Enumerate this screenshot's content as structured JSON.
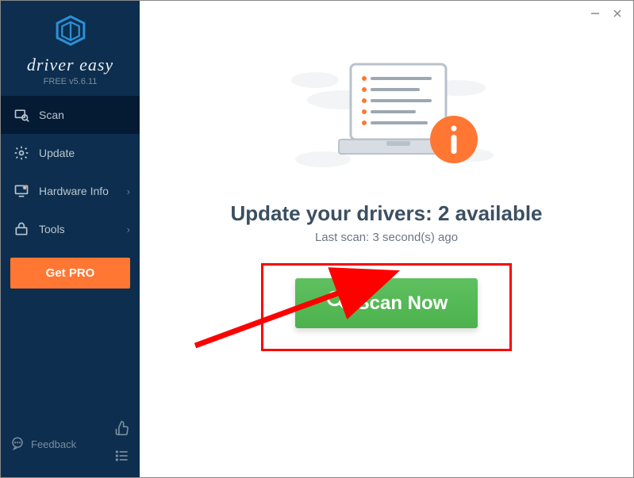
{
  "brand": {
    "name": "driver easy",
    "version": "FREE v5.6.11"
  },
  "sidebar": {
    "items": [
      {
        "label": "Scan"
      },
      {
        "label": "Update"
      },
      {
        "label": "Hardware Info"
      },
      {
        "label": "Tools"
      }
    ],
    "get_pro_label": "Get PRO",
    "feedback_label": "Feedback"
  },
  "main": {
    "headline": "Update your drivers: 2 available",
    "last_scan": "Last scan: 3 second(s) ago",
    "scan_button_label": "Scan Now"
  },
  "colors": {
    "sidebar_bg": "#0d2e4e",
    "accent_orange": "#ff7733",
    "scan_green": "#4cb24d",
    "annotation_red": "#ff0000"
  }
}
